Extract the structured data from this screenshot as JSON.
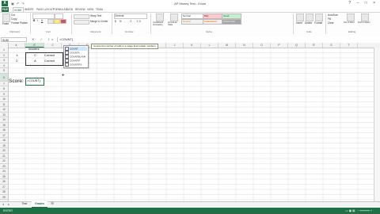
{
  "window": {
    "title": "AP Money Test - Excel",
    "controls": [
      "?",
      "–",
      "□",
      "×"
    ]
  },
  "ribbon": {
    "tabs": [
      "FILE",
      "HOME",
      "INSERT",
      "PAGE LAYOUT",
      "FORMULAS",
      "DATA",
      "REVIEW",
      "VIEW",
      "TEAM"
    ],
    "active_tab": "HOME",
    "clipboard": {
      "cut": "Cut",
      "copy": "Copy",
      "format_painter": "Format Painter",
      "paste": "Paste",
      "label": "Clipboard"
    },
    "font": {
      "label": "Font",
      "bold": "B",
      "italic": "I",
      "underline": "U"
    },
    "alignment": {
      "wrap_text": "Wrap Text",
      "merge_center": "Merge & Center",
      "label": "Alignment"
    },
    "number": {
      "format": "General",
      "label": "Number"
    },
    "styles": {
      "conditional": "Conditional Formatting",
      "format_as_table": "Format as Table",
      "cell_styles": [
        "Normal",
        "Bad",
        "Good",
        "Neutral"
      ],
      "calc_styles": [
        "Calculation",
        "Check Cell"
      ],
      "label": "Styles"
    },
    "cells": {
      "insert": "Insert",
      "delete": "Delete",
      "format": "Format",
      "label": "Cells"
    },
    "editing": {
      "autosum": "AutoSum",
      "fill": "Fill",
      "clear": "Clear",
      "sort_filter": "Sort & Filter",
      "find_select": "Find & Select",
      "label": "Editing"
    }
  },
  "formula_bar": {
    "name_box": "SUM",
    "fx_icons": [
      "✕",
      "✓",
      "fx"
    ],
    "value": "=COUNT("
  },
  "columns": [
    "A",
    "B",
    "C",
    "D",
    "E",
    "F",
    "G",
    "H",
    "I",
    "J",
    "K",
    "L",
    "M",
    "N",
    "O",
    "P",
    "Q",
    "R",
    "S",
    "T",
    "U"
  ],
  "selected_column": "B",
  "rows": [
    "1",
    "2",
    "3",
    "4",
    "5",
    "6",
    "7",
    "8",
    "9",
    "10",
    "11",
    "12",
    "13",
    "14",
    "15",
    "16",
    "17",
    "18",
    "19",
    "20",
    "21",
    "22",
    "23",
    "24",
    "25",
    "26",
    "27",
    "28",
    "29",
    "30",
    "31",
    "32"
  ],
  "selected_row": "6",
  "cells": {
    "B1": "Answers",
    "A2": "1.",
    "B2": "C",
    "C2": "Correct",
    "A3": "2.",
    "B3": "A",
    "C3": "Correct",
    "A6": "Score:",
    "B6": "=COUNT("
  },
  "autocomplete": {
    "tooltip": "Counts the number of cells in a range that contain numbers",
    "items": [
      "COUNT",
      "COUNTA",
      "COUNTBLANK",
      "COUNTIF",
      "COUNTIFS"
    ],
    "highlighted": "COUNT"
  },
  "sheets": [
    "Test",
    "Grades"
  ],
  "active_sheet": "Grades",
  "status": {
    "mode": "ENTER"
  },
  "colors": {
    "accent": "#1e7145",
    "selection": "#d3e5d9"
  }
}
